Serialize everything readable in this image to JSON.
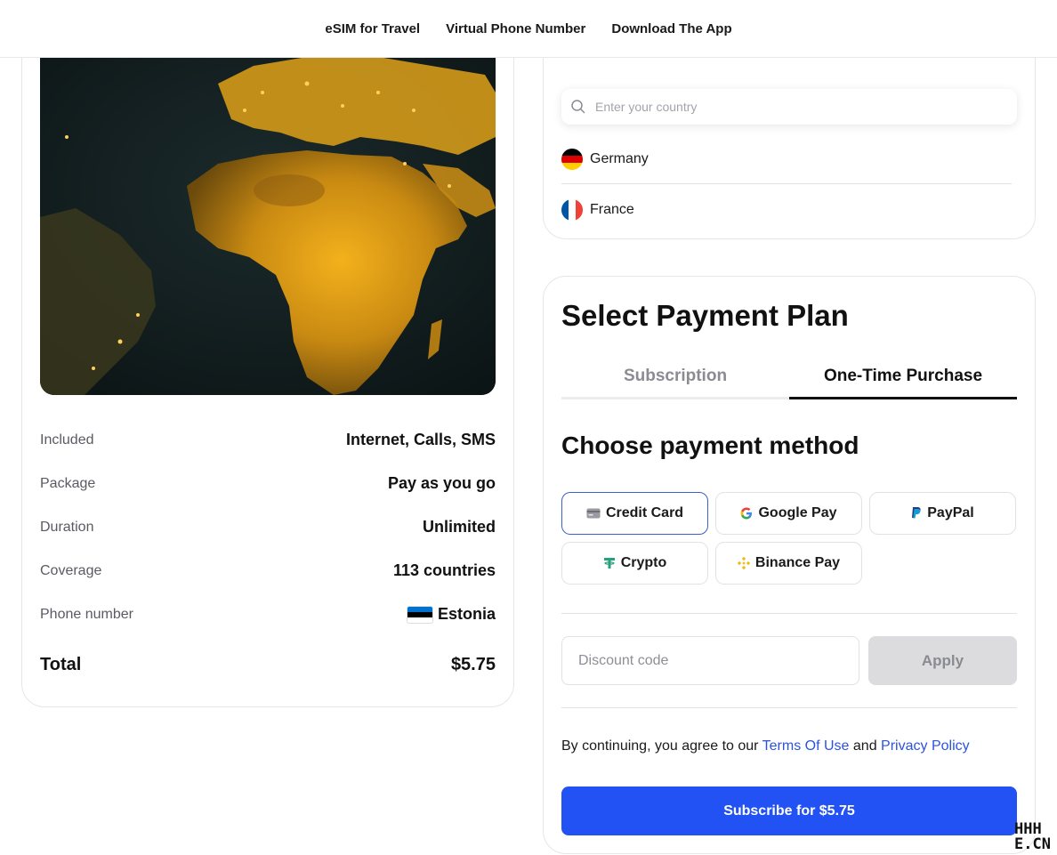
{
  "nav": {
    "items": [
      {
        "label": "eSIM for Travel"
      },
      {
        "label": "Virtual Phone Number"
      },
      {
        "label": "Download The App"
      }
    ]
  },
  "plan": {
    "rows": [
      {
        "label": "Included",
        "value": "Internet, Calls, SMS"
      },
      {
        "label": "Package",
        "value": "Pay as you go"
      },
      {
        "label": "Duration",
        "value": "Unlimited"
      },
      {
        "label": "Coverage",
        "value": "113 countries"
      },
      {
        "label": "Phone number",
        "value": "Estonia"
      }
    ],
    "total_label": "Total",
    "total_value": "$5.75"
  },
  "countries": {
    "search_placeholder": "Enter your country",
    "list": [
      {
        "name": "Germany"
      },
      {
        "name": "France"
      }
    ]
  },
  "payment": {
    "title": "Select Payment Plan",
    "tabs": [
      {
        "label": "Subscription",
        "active": false
      },
      {
        "label": "One-Time Purchase",
        "active": true
      }
    ],
    "method_title": "Choose payment method",
    "methods": [
      {
        "label": "Credit Card",
        "icon": "credit-card-icon",
        "selected": true
      },
      {
        "label": "Google Pay",
        "icon": "google-icon",
        "selected": false
      },
      {
        "label": "PayPal",
        "icon": "paypal-icon",
        "selected": false
      },
      {
        "label": "Crypto",
        "icon": "tether-icon",
        "selected": false
      },
      {
        "label": "Binance Pay",
        "icon": "binance-icon",
        "selected": false
      }
    ],
    "discount_placeholder": "Discount code",
    "apply_label": "Apply",
    "terms": {
      "prefix": "By continuing, you agree to our",
      "terms_link": "Terms Of Use",
      "joiner": "and",
      "privacy_link": "Privacy Policy"
    },
    "subscribe_label": "Subscribe for $5.75"
  },
  "watermark": {
    "line1": "HHH",
    "line2": "E.CN"
  },
  "colors": {
    "accent": "#2352f4",
    "link": "#2b53de",
    "selected_border": "#3a5fcf"
  }
}
